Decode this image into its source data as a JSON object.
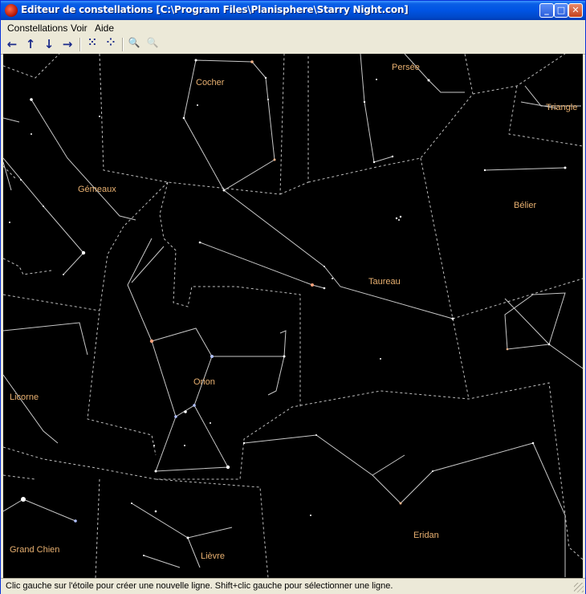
{
  "window": {
    "title": "Editeur de constellations [C:\\Program Files\\Planisphere\\Starry Night.con]",
    "controls": {
      "minimize": "_",
      "maximize": "□",
      "close": "✕"
    }
  },
  "menu": [
    {
      "label": "Constellations"
    },
    {
      "label": "Voir"
    },
    {
      "label": "Aide"
    }
  ],
  "toolbar": [
    {
      "icon": "arrow-left-icon",
      "glyph": "←"
    },
    {
      "icon": "arrow-up-icon",
      "glyph": "↑"
    },
    {
      "icon": "arrow-down-icon",
      "glyph": "↓"
    },
    {
      "icon": "arrow-right-icon",
      "glyph": "→"
    },
    {
      "icon": "stars-icon",
      "glyph": "⁙"
    },
    {
      "icon": "stars-small-icon",
      "glyph": "⁘"
    },
    {
      "icon": "zoom-in-icon",
      "glyph": "🔍"
    },
    {
      "icon": "zoom-out-icon",
      "glyph": "🔍"
    }
  ],
  "constellations": [
    {
      "key": "cocher",
      "name": "Cocher"
    },
    {
      "key": "persee",
      "name": "Persée"
    },
    {
      "key": "triangle",
      "name": "Triangle"
    },
    {
      "key": "gemeaux",
      "name": "Gémeaux"
    },
    {
      "key": "belier",
      "name": "Bélier"
    },
    {
      "key": "taureau",
      "name": "Taureau"
    },
    {
      "key": "orion",
      "name": "Orion"
    },
    {
      "key": "licorne",
      "name": "Licorne"
    },
    {
      "key": "eridan",
      "name": "Eridan"
    },
    {
      "key": "grand-chien",
      "name": "Grand Chien"
    },
    {
      "key": "lievre",
      "name": "Lièvre"
    }
  ],
  "status": {
    "text": "Clic gauche sur l'étoile pour créer une nouvelle ligne. Shift+clic gauche pour sélectionner une ligne."
  },
  "colors": {
    "sky": "#000000",
    "label": "#e8b070",
    "lines": "#c8c8c8",
    "boundaries": "#bdbdbd"
  }
}
